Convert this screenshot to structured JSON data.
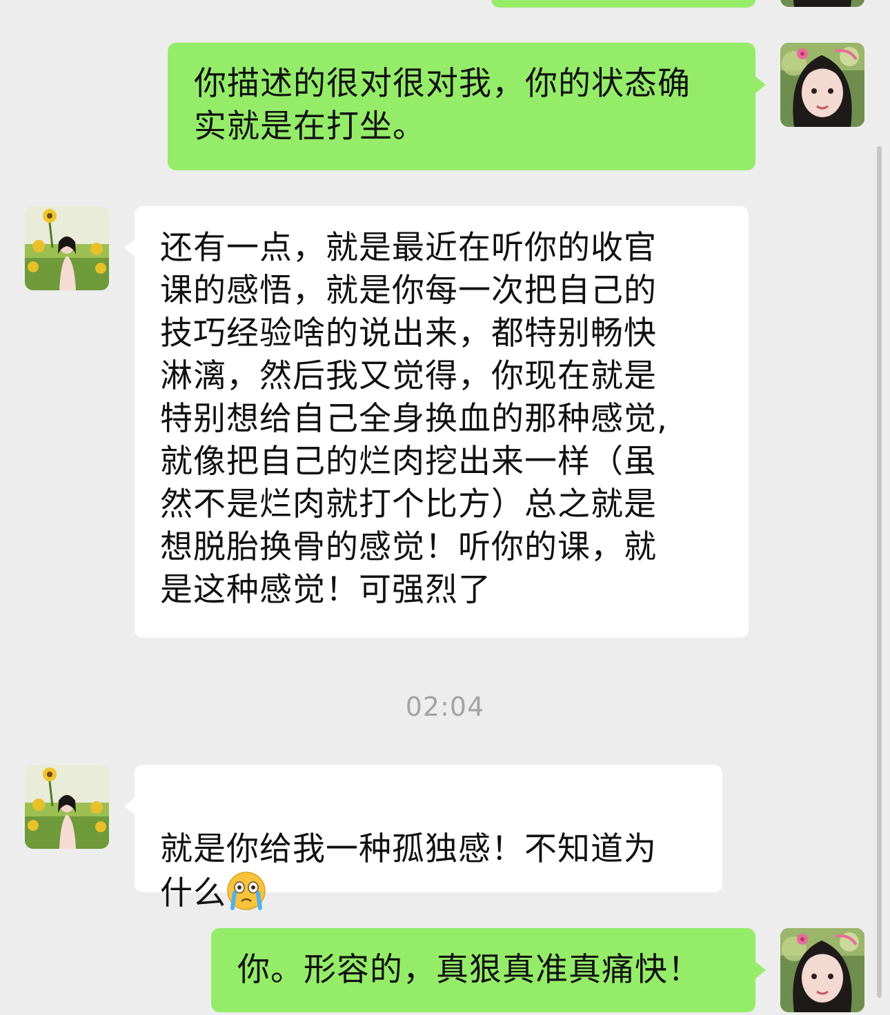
{
  "messages": [
    {
      "id": "m0",
      "side": "right",
      "text": ""
    },
    {
      "id": "m1",
      "side": "right",
      "text": "你描述的很对很对我，你的状态确\n实就是在打坐。"
    },
    {
      "id": "m2",
      "side": "left",
      "text": "还有一点，就是最近在听你的收官\n课的感悟，就是你每一次把自己的\n技巧经验啥的说出来，都特别畅快\n淋漓，然后我又觉得，你现在就是\n特别想给自己全身换血的那种感觉,\n就像把自己的烂肉挖出来一样（虽\n然不是烂肉就打个比方）总之就是\n想脱胎换骨的感觉！听你的课，就\n是这种感觉！可强烈了"
    },
    {
      "id": "m3",
      "side": "left",
      "text": "就是你给我一种孤独感！不知道为\n什么"
    },
    {
      "id": "m4",
      "side": "right",
      "text": "你。形容的，真狠真准真痛快！"
    }
  ],
  "timestamp": "02:04",
  "emoji": {
    "name": "loudly-crying-face-emoji"
  },
  "colors": {
    "background": "#ededed",
    "self_bubble": "#95ec69",
    "other_bubble": "#ffffff",
    "timestamp": "#a3a3a3"
  },
  "avatars": {
    "self": "self-avatar-girl-pink-bow",
    "other": "other-avatar-sunflower-field"
  }
}
